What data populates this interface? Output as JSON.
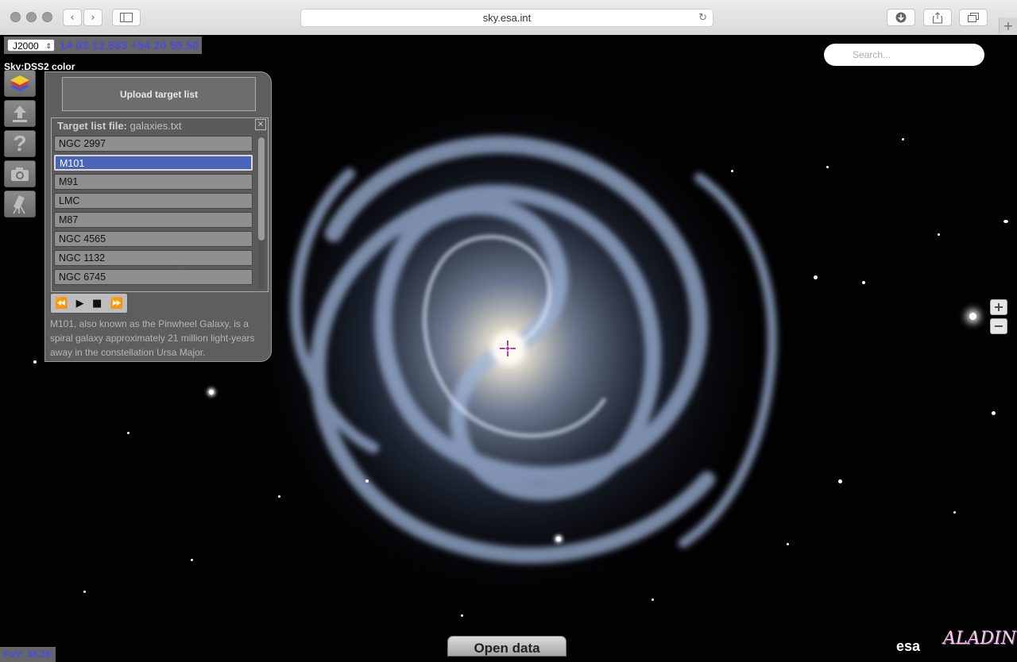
{
  "browser": {
    "url": "sky.esa.int",
    "new_tab_label": "+"
  },
  "coords": {
    "frame": "J2000",
    "value": "14 03 12.583 +54 20 55.50"
  },
  "survey": {
    "label": "Sky:DSS2 color"
  },
  "toolbar": {
    "tools": [
      "layers-icon",
      "upload-icon",
      "help-icon",
      "camera-icon",
      "telescope-icon"
    ]
  },
  "panel": {
    "upload_label": "Upload target list",
    "list_title": "Target list file:",
    "list_file": "galaxies.txt",
    "items": [
      "NGC 2997",
      "M101",
      "M91",
      "LMC",
      "M87",
      "NGC 4565",
      "NGC 1132",
      "NGC 6745"
    ],
    "selected_index": 1,
    "description": "M101, also known as the Pinwheel Galaxy, is a spiral galaxy approximately 21 million light-years away in the constellation Ursa Major."
  },
  "search": {
    "placeholder": "Search..."
  },
  "zoom": {
    "in_label": "+",
    "out_label": "−"
  },
  "footer": {
    "open_data": "Open data",
    "fov": "FoV: 34.28'",
    "esa": "esa",
    "aladin": "ALADIN"
  },
  "colors": {
    "coord_text": "#4a4ae8",
    "selected_item": "#4b66b8"
  }
}
